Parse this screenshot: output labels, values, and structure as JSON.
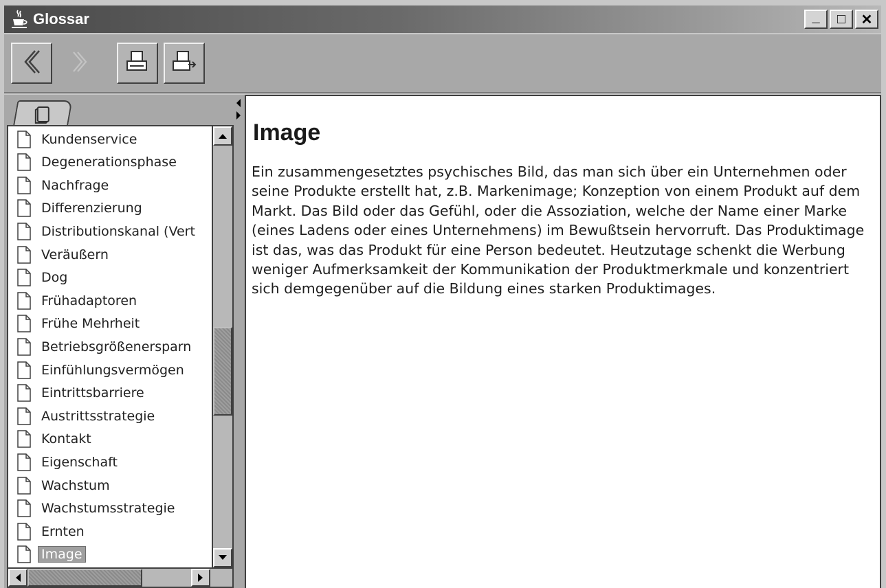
{
  "window": {
    "title": "Glossar",
    "icon": "java-cup-icon",
    "controls": [
      "_",
      "□",
      "✕"
    ]
  },
  "toolbar": {
    "buttons": [
      {
        "name": "back",
        "icon": "chevron-left-icon",
        "enabled": true
      },
      {
        "name": "forward",
        "icon": "chevron-right-icon",
        "enabled": false
      },
      {
        "name": "print",
        "icon": "printer-icon",
        "enabled": true
      },
      {
        "name": "print-setup",
        "icon": "printer-arrow-icon",
        "enabled": true
      }
    ]
  },
  "navigator": {
    "tab_icon": "book-icon",
    "items": [
      {
        "label": "Kundenservice"
      },
      {
        "label": "Degenerationsphase"
      },
      {
        "label": "Nachfrage"
      },
      {
        "label": "Differenzierung"
      },
      {
        "label": "Distributionskanal (Vert"
      },
      {
        "label": "Veräußern"
      },
      {
        "label": "Dog"
      },
      {
        "label": "Frühadaptoren"
      },
      {
        "label": "Frühe Mehrheit"
      },
      {
        "label": "Betriebsgrößenersparn"
      },
      {
        "label": "Einfühlungsvermögen"
      },
      {
        "label": "Eintrittsbarriere"
      },
      {
        "label": "Austrittsstrategie"
      },
      {
        "label": "Kontakt"
      },
      {
        "label": "Eigenschaft"
      },
      {
        "label": "Wachstum"
      },
      {
        "label": "Wachstumsstrategie"
      },
      {
        "label": "Ernten"
      },
      {
        "label": "Image",
        "selected": true
      }
    ],
    "vertical_scroll_fraction": 0.45,
    "horizontal_scroll_fraction": 0.25
  },
  "content": {
    "heading": "Image",
    "body": "Ein zusammengesetztes psychisches Bild, das man sich über ein Unternehmen oder seine Produkte erstellt hat, z.B. Markenimage; Konzeption von einem Produkt auf dem Markt. Das Bild oder das Gefühl, oder die Assoziation, welche der Name einer Marke (eines Ladens oder eines Unternehmens) im Bewußtsein hervorruft. Das Produktimage ist das, was das Produkt für eine Person bedeutet. Heutzutage schenkt die Werbung weniger Aufmerksamkeit der Kommunikation der Produktmerkmale und konzentriert sich demgegenüber auf die Bildung eines starken Produktimages."
  },
  "colors": {
    "titlebar_start": "#4a4a4a",
    "titlebar_end": "#b8b8b8",
    "toolbar": "#a8a8a8",
    "selection": "#a0a0a0"
  }
}
